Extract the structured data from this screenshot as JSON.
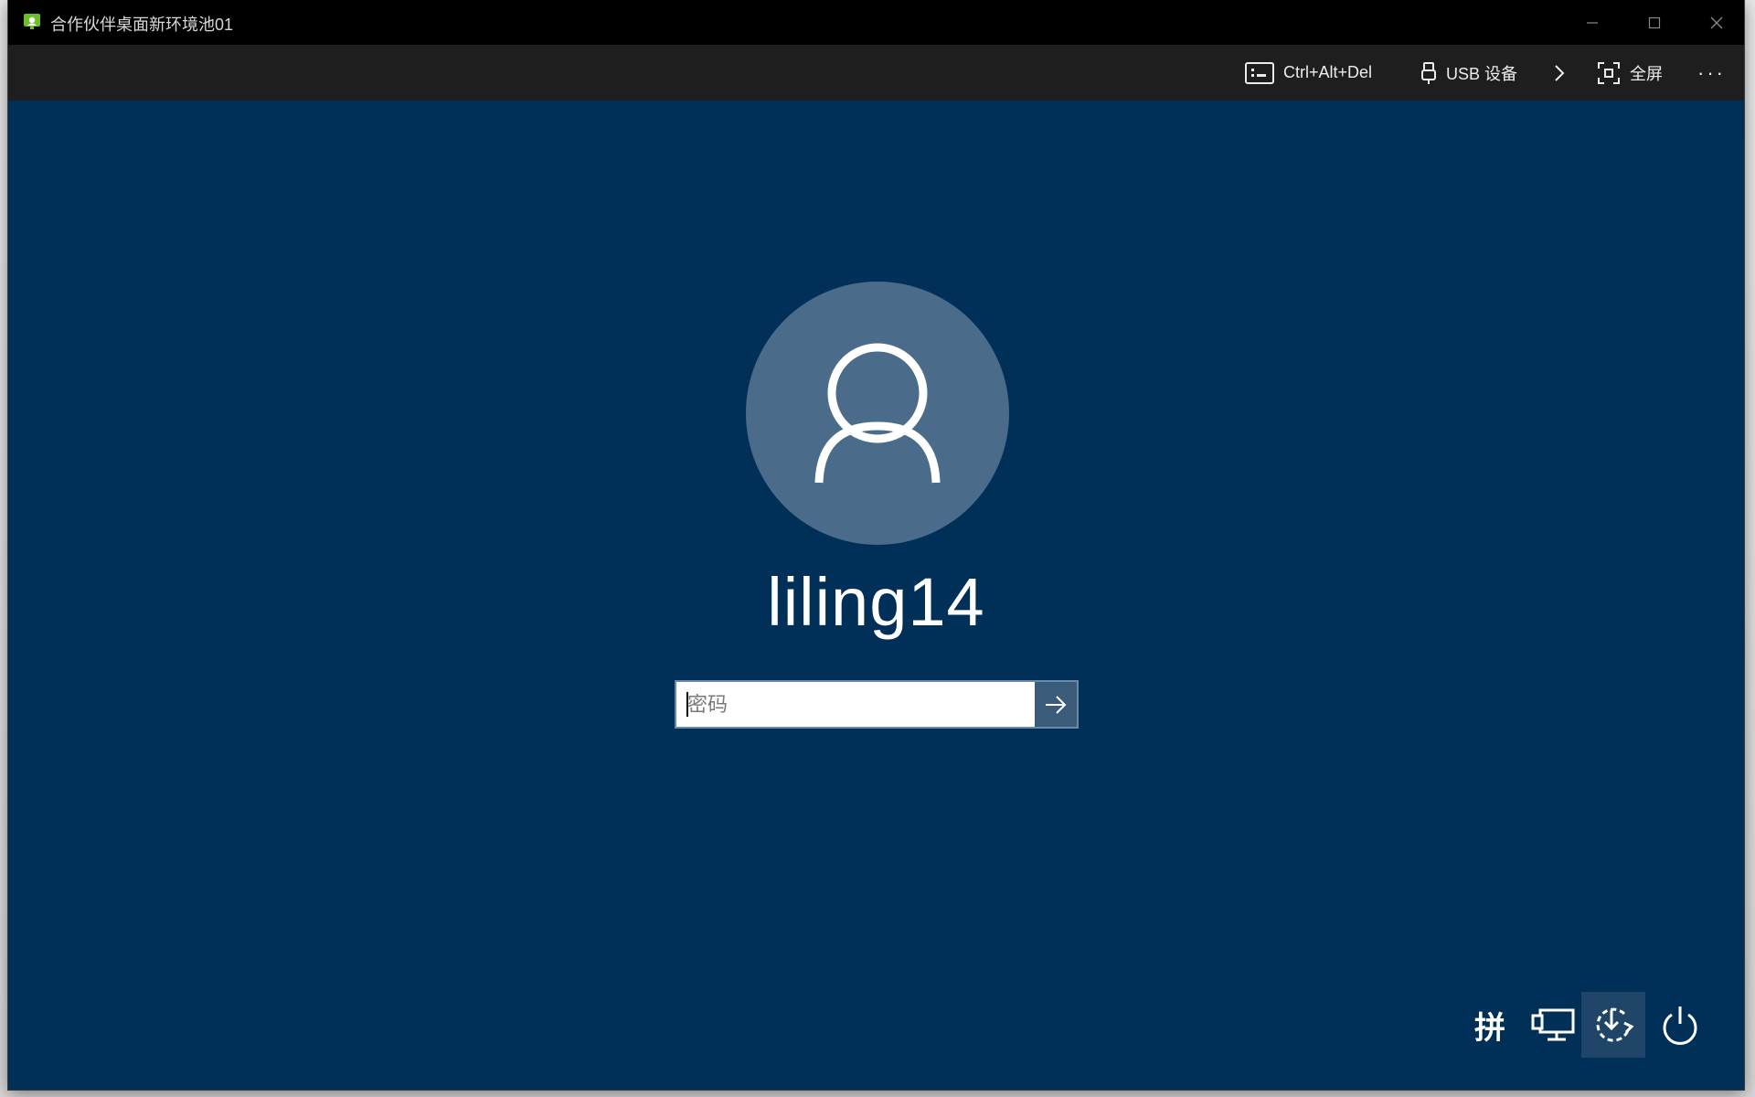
{
  "window": {
    "title": "合作伙伴桌面新环境池01",
    "app_icon": "remote-desktop-icon",
    "controls": {
      "minimize": "minimize-icon",
      "maximize": "maximize-icon",
      "close": "close-icon"
    }
  },
  "toolbar": {
    "ctrl_alt_del_label": "Ctrl+Alt+Del",
    "usb_label": "USB 设备",
    "fullscreen_label": "全屏",
    "more_label": "···"
  },
  "login": {
    "username": "liling14",
    "password_placeholder": "密码",
    "password_value": ""
  },
  "bottom_bar": {
    "ime_label": "拼",
    "icons": [
      "ime-icon",
      "network-icon",
      "accessibility-icon",
      "power-icon"
    ]
  },
  "colors": {
    "screen_bg": "#003057",
    "avatar_bg": "#4a6c8a",
    "titlebar_bg": "#000000",
    "toolbar_bg": "#1e1e1e",
    "submit_bg": "#3a5c7a",
    "app_icon_green": "#6abf2a"
  }
}
